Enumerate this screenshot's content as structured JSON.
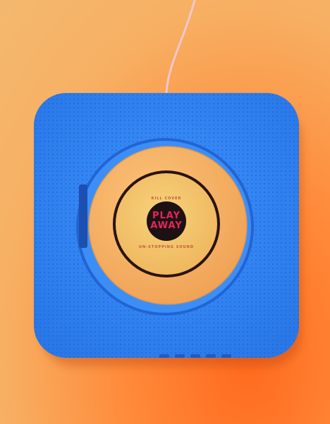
{
  "device": {
    "logo_top": "KILL COVER",
    "logo_main_line1": "PLAY",
    "logo_main_line2": "AWAY",
    "logo_bottom": "UN-STOPPING SOUND"
  },
  "colors": {
    "body": "#2f86f2",
    "disc": "#f4b768",
    "cap": "#f2c466",
    "background": "#f6a44f",
    "label_red": "#e8245a"
  }
}
